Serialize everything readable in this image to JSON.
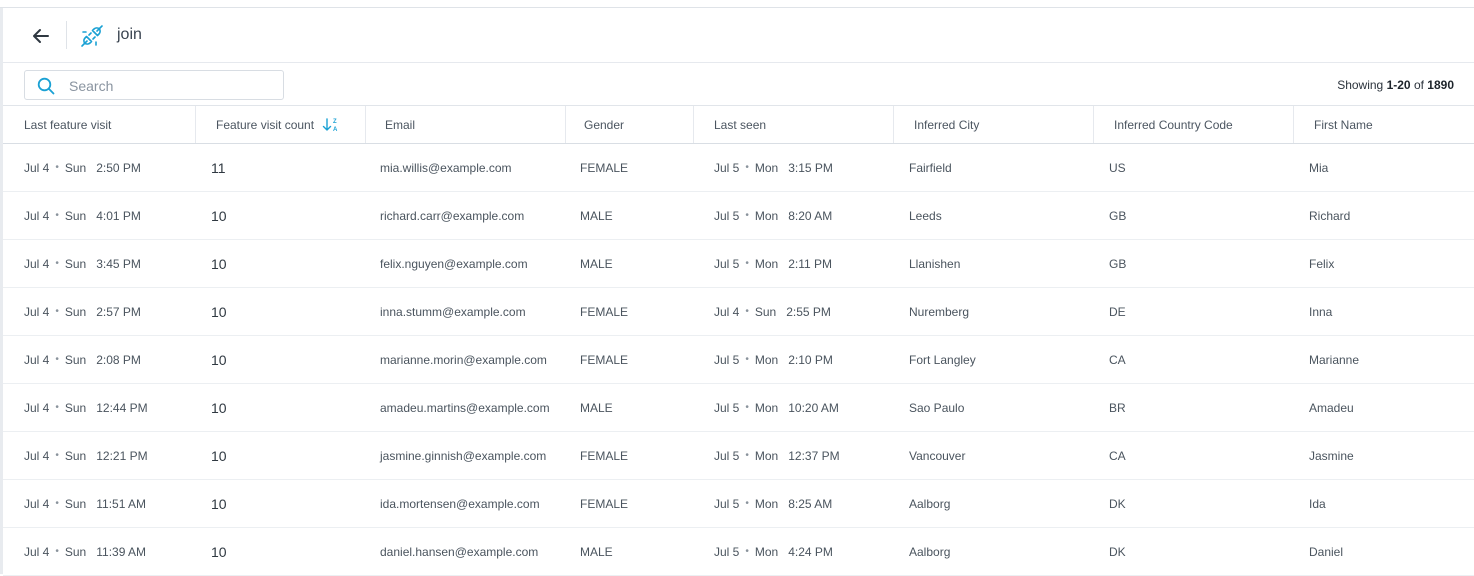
{
  "header": {
    "title": "join"
  },
  "search": {
    "placeholder": "Search",
    "value": ""
  },
  "pagination": {
    "prefix": "Showing ",
    "range": "1-20",
    "of": " of ",
    "total": "1890"
  },
  "columns": [
    "Last feature visit",
    "Feature visit count",
    "Email",
    "Gender",
    "Last seen",
    "Inferred City",
    "Inferred Country Code",
    "First Name"
  ],
  "rows": [
    {
      "lfv_date": "Jul 4",
      "lfv_day": "Sun",
      "lfv_time": "2:50 PM",
      "count": "11",
      "email": "mia.willis@example.com",
      "gender": "FEMALE",
      "ls_date": "Jul 5",
      "ls_day": "Mon",
      "ls_time": "3:15 PM",
      "city": "Fairfield",
      "country": "US",
      "first_name": "Mia"
    },
    {
      "lfv_date": "Jul 4",
      "lfv_day": "Sun",
      "lfv_time": "4:01 PM",
      "count": "10",
      "email": "richard.carr@example.com",
      "gender": "MALE",
      "ls_date": "Jul 5",
      "ls_day": "Mon",
      "ls_time": "8:20 AM",
      "city": "Leeds",
      "country": "GB",
      "first_name": "Richard"
    },
    {
      "lfv_date": "Jul 4",
      "lfv_day": "Sun",
      "lfv_time": "3:45 PM",
      "count": "10",
      "email": "felix.nguyen@example.com",
      "gender": "MALE",
      "ls_date": "Jul 5",
      "ls_day": "Mon",
      "ls_time": "2:11 PM",
      "city": "Llanishen",
      "country": "GB",
      "first_name": "Felix"
    },
    {
      "lfv_date": "Jul 4",
      "lfv_day": "Sun",
      "lfv_time": "2:57 PM",
      "count": "10",
      "email": "inna.stumm@example.com",
      "gender": "FEMALE",
      "ls_date": "Jul 4",
      "ls_day": "Sun",
      "ls_time": "2:55 PM",
      "city": "Nuremberg",
      "country": "DE",
      "first_name": "Inna"
    },
    {
      "lfv_date": "Jul 4",
      "lfv_day": "Sun",
      "lfv_time": "2:08 PM",
      "count": "10",
      "email": "marianne.morin@example.com",
      "gender": "FEMALE",
      "ls_date": "Jul 5",
      "ls_day": "Mon",
      "ls_time": "2:10 PM",
      "city": "Fort Langley",
      "country": "CA",
      "first_name": "Marianne"
    },
    {
      "lfv_date": "Jul 4",
      "lfv_day": "Sun",
      "lfv_time": "12:44 PM",
      "count": "10",
      "email": "amadeu.martins@example.com",
      "gender": "MALE",
      "ls_date": "Jul 5",
      "ls_day": "Mon",
      "ls_time": "10:20 AM",
      "city": "Sao Paulo",
      "country": "BR",
      "first_name": "Amadeu"
    },
    {
      "lfv_date": "Jul 4",
      "lfv_day": "Sun",
      "lfv_time": "12:21 PM",
      "count": "10",
      "email": "jasmine.ginnish@example.com",
      "gender": "FEMALE",
      "ls_date": "Jul 5",
      "ls_day": "Mon",
      "ls_time": "12:37 PM",
      "city": "Vancouver",
      "country": "CA",
      "first_name": "Jasmine"
    },
    {
      "lfv_date": "Jul 4",
      "lfv_day": "Sun",
      "lfv_time": "11:51 AM",
      "count": "10",
      "email": "ida.mortensen@example.com",
      "gender": "FEMALE",
      "ls_date": "Jul 5",
      "ls_day": "Mon",
      "ls_time": "8:25 AM",
      "city": "Aalborg",
      "country": "DK",
      "first_name": "Ida"
    },
    {
      "lfv_date": "Jul 4",
      "lfv_day": "Sun",
      "lfv_time": "11:39 AM",
      "count": "10",
      "email": "daniel.hansen@example.com",
      "gender": "MALE",
      "ls_date": "Jul 5",
      "ls_day": "Mon",
      "ls_time": "4:24 PM",
      "city": "Aalborg",
      "country": "DK",
      "first_name": "Daniel"
    }
  ],
  "icons": {
    "back": "arrow-left-icon",
    "feature": "plug-icon",
    "search": "search-icon",
    "sort": "sort-descending-icon"
  },
  "colors": {
    "accent": "#1aa1d4",
    "text": "#4a545e"
  }
}
